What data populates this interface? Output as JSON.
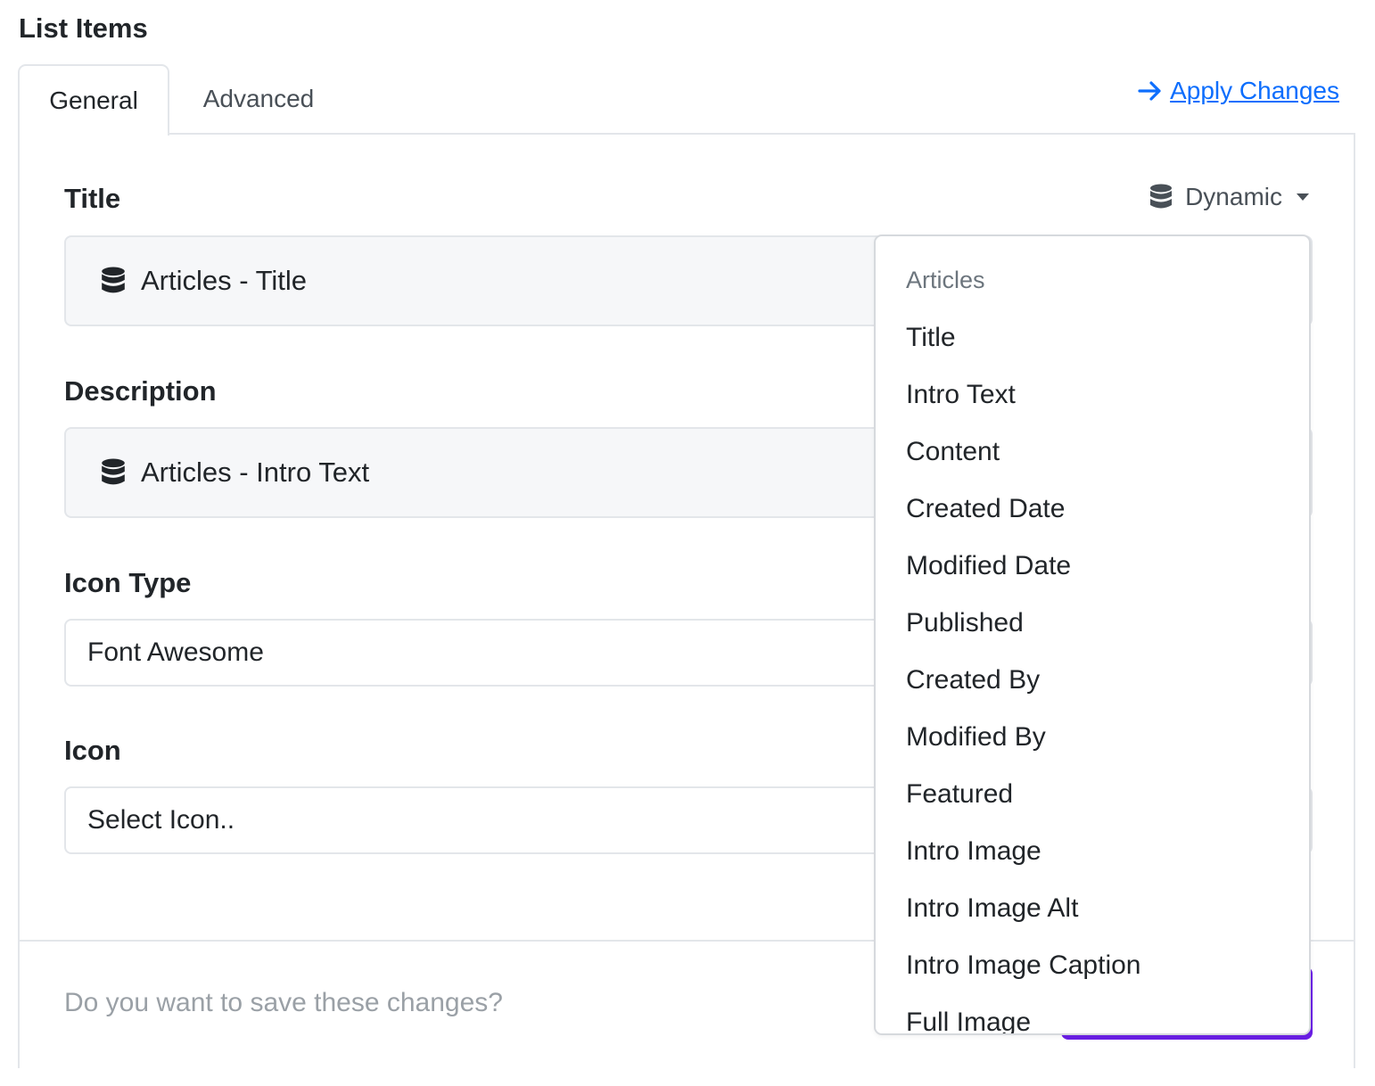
{
  "page": {
    "heading": "List Items"
  },
  "tabs": [
    {
      "label": "General",
      "active": true
    },
    {
      "label": "Advanced",
      "active": false
    }
  ],
  "apply_link": {
    "label": "Apply Changes",
    "icon": "arrow-right-icon",
    "color": "#0d6efd"
  },
  "form": {
    "title": {
      "label": "Title",
      "dynamic_toggle": {
        "label": "Dynamic",
        "icon": "database-icon"
      },
      "value": "Articles - Title",
      "icon": "database-icon"
    },
    "description": {
      "label": "Description",
      "value": "Articles - Intro Text",
      "icon": "database-icon"
    },
    "icon_type": {
      "label": "Icon Type",
      "value": "Font Awesome"
    },
    "icon": {
      "label": "Icon",
      "value": "Select Icon.."
    }
  },
  "footer": {
    "prompt": "Do you want to save these changes?",
    "button_color": "#6b1fe6"
  },
  "dropdown": {
    "header": "Articles",
    "items": [
      "Title",
      "Intro Text",
      "Content",
      "Created Date",
      "Modified Date",
      "Published",
      "Created By",
      "Modified By",
      "Featured",
      "Intro Image",
      "Intro Image Alt",
      "Intro Image Caption",
      "Full Image"
    ]
  }
}
